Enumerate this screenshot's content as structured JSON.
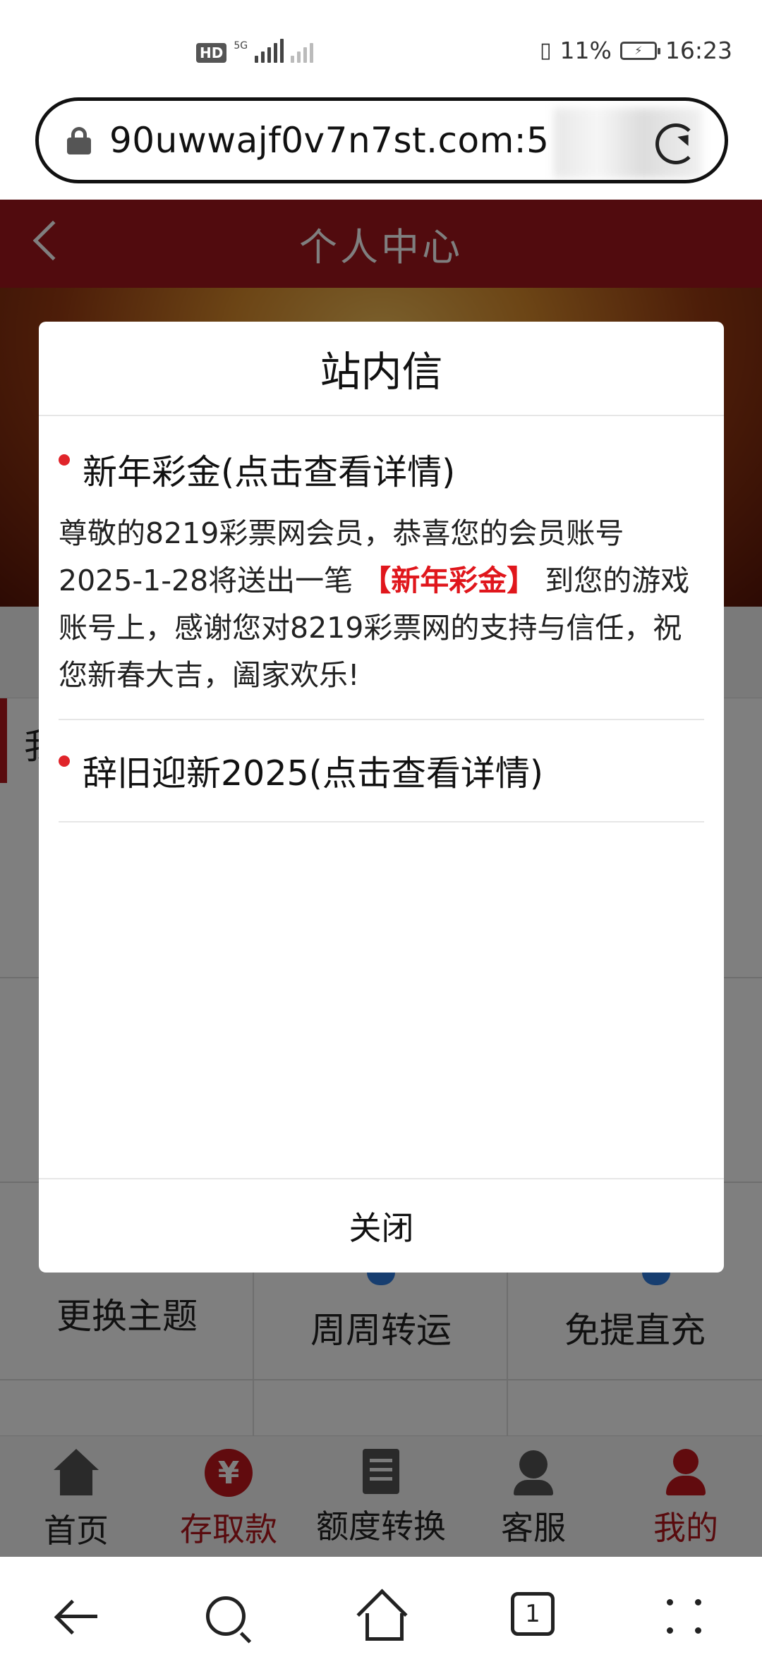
{
  "status_bar": {
    "hd_label": "HD",
    "net_label": "5G",
    "battery_percent": "11%",
    "time": "16:23"
  },
  "browser": {
    "url": "90uwwajf0v7n7st.com:5"
  },
  "header": {
    "title": "个人中心"
  },
  "background": {
    "section_label": "我",
    "grid_items": [
      "更换主题",
      "周周转运",
      "免提直充"
    ]
  },
  "modal": {
    "title": "站内信",
    "messages": [
      {
        "title": "新年彩金(点击查看详情)",
        "body_prefix": "尊敬的8219彩票网会员，恭喜您的会员账号2025-1-28将送出一笔",
        "body_highlight": "【新年彩金】",
        "body_suffix": "到您的游戏账号上，感谢您对8219彩票网的支持与信任，祝您新春大吉，阖家欢乐!"
      },
      {
        "title": "辞旧迎新2025(点击查看详情)"
      }
    ],
    "close_label": "关闭"
  },
  "bottom_nav": {
    "items": [
      {
        "label": "首页",
        "icon": "home-icon"
      },
      {
        "label": "存取款",
        "icon": "yen-icon"
      },
      {
        "label": "额度转换",
        "icon": "receipt-icon"
      },
      {
        "label": "客服",
        "icon": "support-agent-icon"
      },
      {
        "label": "我的",
        "icon": "user-icon"
      }
    ]
  },
  "system_nav": {
    "tab_count": "1"
  },
  "colors": {
    "brand_red": "#a3161c",
    "highlight_red": "#e0161c"
  }
}
